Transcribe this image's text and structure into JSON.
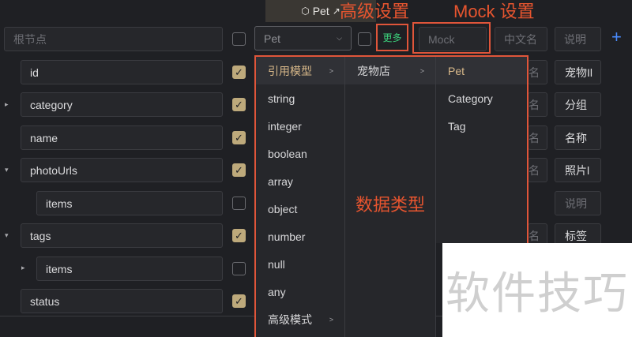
{
  "header": {
    "model_title": "Pet"
  },
  "root_row": {
    "name_placeholder": "根节点",
    "type_value": "Pet",
    "more_label": "更多",
    "mock_placeholder": "Mock",
    "cn_name_placeholder": "中文名",
    "desc_placeholder": "说明"
  },
  "rows": [
    {
      "name": "id",
      "checked": true,
      "cn": "名",
      "desc": "宠物Il"
    },
    {
      "name": "category",
      "checked": true,
      "cn": "名",
      "desc": "分组"
    },
    {
      "name": "name",
      "checked": true,
      "cn": "名",
      "desc": "名称"
    },
    {
      "name": "photoUrls",
      "checked": true,
      "cn": "名",
      "desc": "照片l"
    },
    {
      "name": "items",
      "checked": false,
      "cn": "",
      "desc": "说明"
    },
    {
      "name": "tags",
      "checked": true,
      "cn": "名",
      "desc": "标签"
    },
    {
      "name": "items",
      "checked": false,
      "cn": "",
      "desc": ""
    },
    {
      "name": "status",
      "checked": true,
      "cn": "",
      "desc": ""
    }
  ],
  "type_menu": {
    "items": [
      "引用模型",
      "string",
      "integer",
      "boolean",
      "array",
      "object",
      "number",
      "null",
      "any",
      "高级模式"
    ],
    "ref_submenu": [
      "宠物店"
    ],
    "model_submenu": [
      "Pet",
      "Category",
      "Tag"
    ]
  },
  "annotations": {
    "advanced": "高级设置",
    "mock": "Mock 设置",
    "datatype": "数据类型"
  },
  "watermark": "软件技巧",
  "colors": {
    "accent_check": "#bda97b",
    "annotation": "#e0553a",
    "more_green": "#3ccf7a",
    "plus_blue": "#4a8cff"
  }
}
